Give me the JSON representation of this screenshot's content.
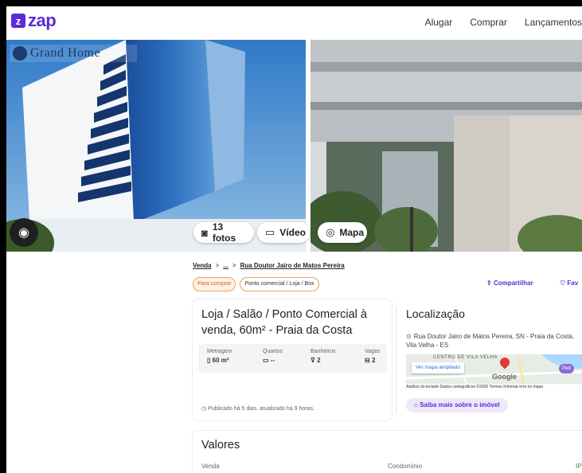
{
  "header": {
    "logo_text": "zap",
    "nav": [
      "Alugar",
      "Comprar",
      "Lançamentos"
    ]
  },
  "gallery": {
    "brand_watermark": "Grand Home",
    "photos_label": "13 fotos",
    "video_label": "Vídeo",
    "map_label": "Mapa"
  },
  "breadcrumb": {
    "first": "Venda",
    "ellipsis": "...",
    "last": "Rua Doutor Jairo de Matos Pereira",
    "sep": ">"
  },
  "tags": [
    "Para comprar",
    "Ponto comercial / Loja / Box"
  ],
  "actions": {
    "share": "Compartilhar",
    "favorite": "Fav"
  },
  "listing": {
    "title": "Loja / Salão / Ponto Comercial à venda, 60m² - Praia da Costa",
    "stats": [
      {
        "label": "Metragem",
        "value": "60 m²",
        "icon": "ruler-icon"
      },
      {
        "label": "Quartos",
        "value": "--",
        "icon": "bed-icon"
      },
      {
        "label": "Banheiros",
        "value": "2",
        "icon": "bath-icon"
      },
      {
        "label": "Vagas",
        "value": "2",
        "icon": "car-icon"
      }
    ],
    "published": "Publicado há 5 dias, atualizado há 9 horas."
  },
  "location": {
    "title": "Localização",
    "address": "Rua Doutor Jairo de Matos Pereira, SN - Praia da Costa, Vila Velha - ES",
    "map_button": "Ver mapa ampliado",
    "map_footer": "Atalhos do teclado   Dados cartográficos ©2026   Termos   Informar erro no mapa",
    "map_area_label": "CENTRO DE VILA VELHA",
    "map_poi": "Ped",
    "map_brand": "Google",
    "learn_more": "Saiba mais sobre o imóvel"
  },
  "values": {
    "title": "Valores",
    "labels": [
      "Venda",
      "Condomínio",
      "IP"
    ]
  },
  "colors": {
    "brand": "#5a2bd6",
    "tag_orange": "#d5601b"
  }
}
